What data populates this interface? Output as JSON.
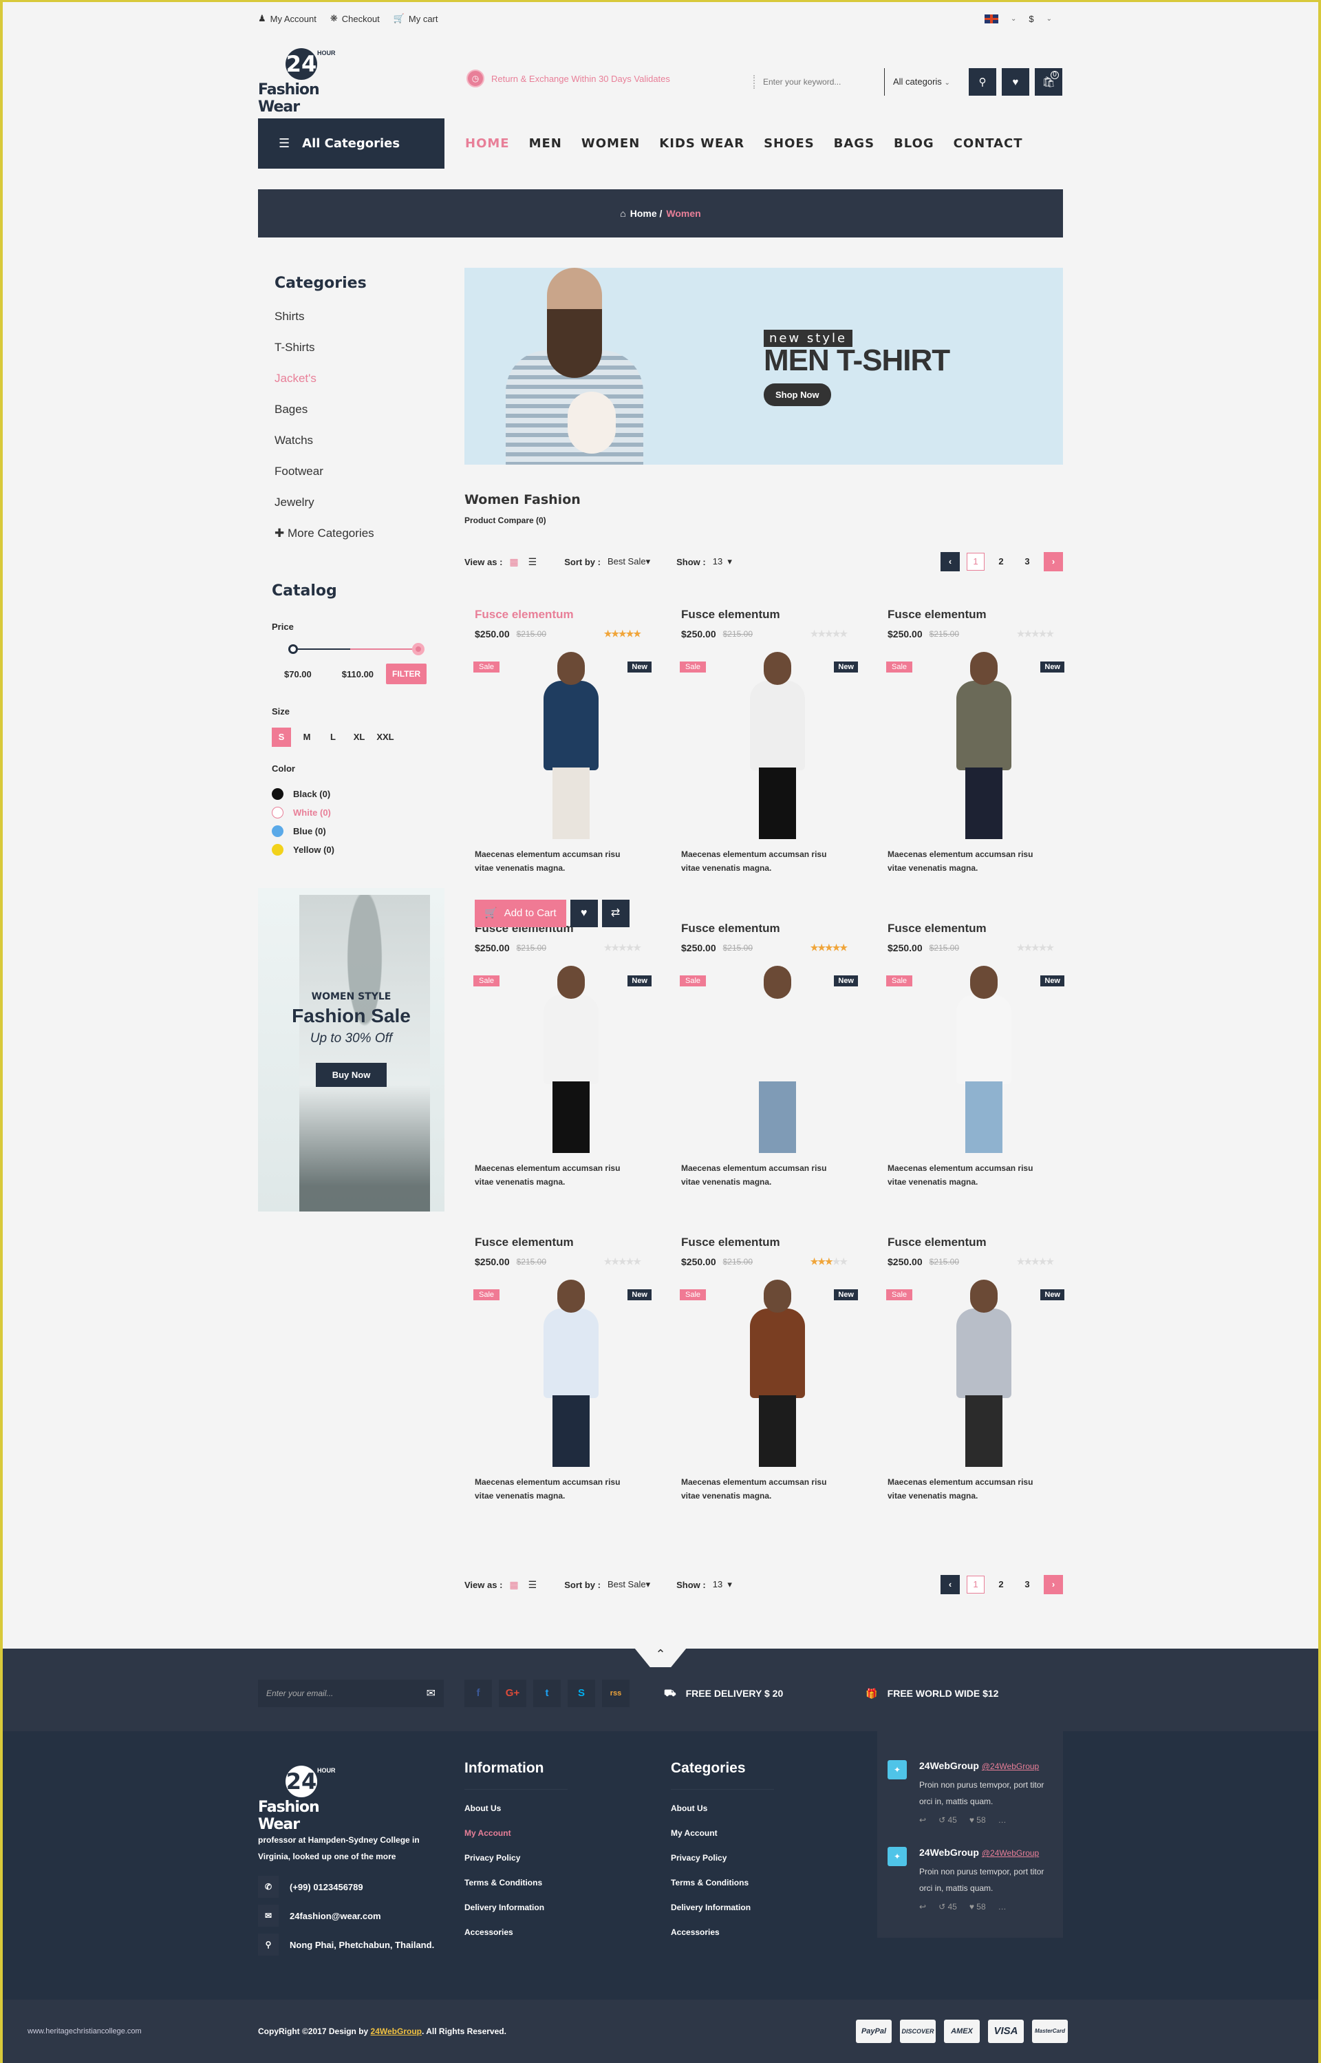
{
  "topbar": {
    "my_account": "My Account",
    "checkout": "Checkout",
    "my_cart": "My cart",
    "currency": "$"
  },
  "header": {
    "logo_number": "24",
    "logo_hour": "HOUR",
    "logo_name": "Fashion Wear",
    "promo_text": "Return & Exchange  Within 30 Days Validates",
    "search_placeholder": "Enter your keyword...",
    "category_select": "All categoris",
    "cart_count": "0"
  },
  "nav": {
    "all_categories": "All Categories",
    "items": [
      "HOME",
      "MEN",
      "WOMEN",
      "KIDS WEAR",
      "SHOES",
      "BAGS",
      "BLOG",
      "CONTACT"
    ],
    "active": "HOME"
  },
  "breadcrumb": {
    "home": "Home /",
    "current": "Women"
  },
  "sidebar": {
    "categories_title": "Categories",
    "categories": [
      "Shirts",
      "T-Shirts",
      "Jacket's",
      "Bages",
      "Watchs",
      "Footwear",
      "Jewelry"
    ],
    "active_category": "Jacket's",
    "more": "More Categories",
    "catalog_title": "Catalog",
    "price_label": "Price",
    "price_min": "$70.00",
    "price_max": "$110.00",
    "filter_button": "FILTER",
    "size_label": "Size",
    "sizes": [
      "S",
      "M",
      "L",
      "XL",
      "XXL"
    ],
    "selected_size": "S",
    "color_label": "Color",
    "colors": [
      {
        "name": "Black (0)",
        "hex": "#111111"
      },
      {
        "name": "White (0)",
        "hex": "#ffffff"
      },
      {
        "name": "Blue (0)",
        "hex": "#5aa9e8"
      },
      {
        "name": "Yellow (0)",
        "hex": "#f2d21b"
      }
    ],
    "active_color": "White (0)",
    "banner": {
      "eyebrow": "WOMEN STYLE",
      "title": "Fashion Sale",
      "subtitle": "Up to 30% Off",
      "button": "Buy Now"
    }
  },
  "hero": {
    "eyebrow": "new style",
    "title": "MEN T-SHIRT",
    "button": "Shop Now"
  },
  "listing": {
    "title": "Women Fashion",
    "compare": "Product Compare (0)",
    "view_as": "View as :",
    "sort_by": "Sort by :",
    "sort_value": "Best Sale",
    "show": "Show :",
    "show_value": "13",
    "pages": [
      "1",
      "2",
      "3"
    ],
    "current_page": "1"
  },
  "product_labels": {
    "sale": "Sale",
    "new": "New",
    "add_to_cart": "Add to Cart"
  },
  "products": [
    {
      "name": "Fusce elementum",
      "price": "$250.00",
      "old_price": "$215.00",
      "rating": 5,
      "desc": "Maecenas elementum accumsan risu vitae venenatis magna.",
      "active": true,
      "hover": true,
      "shirt": "#1f3d60",
      "leg": "#e9e4dd"
    },
    {
      "name": "Fusce elementum",
      "price": "$250.00",
      "old_price": "$215.00",
      "rating": 0,
      "desc": "Maecenas elementum accumsan risu vitae venenatis magna.",
      "shirt": "#eeeeee",
      "leg": "#111111"
    },
    {
      "name": "Fusce elementum",
      "price": "$250.00",
      "old_price": "$215.00",
      "rating": 0,
      "desc": "Maecenas elementum accumsan risu vitae venenatis magna.",
      "shirt": "#6b6a58",
      "leg": "#1d2233"
    },
    {
      "name": "Fusce elementum",
      "price": "$250.00",
      "old_price": "$215.00",
      "rating": 0,
      "desc": "Maecenas elementum accumsan risu vitae venenatis magna.",
      "shirt": "#f2f2f2",
      "leg": "#111111"
    },
    {
      "name": "Fusce elementum",
      "price": "$250.00",
      "old_price": "$215.00",
      "rating": 5,
      "desc": "Maecenas elementum accumsan risu vitae venenatis magna.",
      "shirt": "#f4f4f4",
      "leg": "#7f9bb6"
    },
    {
      "name": "Fusce elementum",
      "price": "$250.00",
      "old_price": "$215.00",
      "rating": 0,
      "desc": "Maecenas elementum accumsan risu vitae venenatis magna.",
      "shirt": "#f6f6f6",
      "leg": "#8fb2cf"
    },
    {
      "name": "Fusce elementum",
      "price": "$250.00",
      "old_price": "$215.00",
      "rating": 0,
      "desc": "Maecenas elementum accumsan risu vitae venenatis magna.",
      "shirt": "#dfe8f3",
      "leg": "#1f2b3e"
    },
    {
      "name": "Fusce elementum",
      "price": "$250.00",
      "old_price": "$215.00",
      "rating": 3,
      "desc": "Maecenas elementum accumsan risu vitae venenatis magna.",
      "shirt": "#7a3e22",
      "leg": "#1c1c1c"
    },
    {
      "name": "Fusce elementum",
      "price": "$250.00",
      "old_price": "$215.00",
      "rating": 0,
      "desc": "Maecenas elementum accumsan risu vitae venenatis magna.",
      "shirt": "#b8bec8",
      "leg": "#2b2b2b"
    }
  ],
  "footer": {
    "email_placeholder": "Enter your email...",
    "socials": [
      "f",
      "G+",
      "t",
      "S",
      "rss"
    ],
    "feature1": "FREE DELIVERY $ 20",
    "feature2": "FREE WORLD WIDE $12",
    "about_text": "professor at Hampden-Sydney College in Virginia, looked up one of the more",
    "phone": "(+99) 0123456789",
    "email": "24fashion@wear.com",
    "address": "Nong Phai, Phetchabun, Thailand.",
    "info_title": "Information",
    "info_links": [
      "About Us",
      "My Account",
      "Privacy Policy",
      "Terms & Conditions",
      "Delivery Information",
      "Accessories"
    ],
    "info_active": "My Account",
    "cat_title": "Categories",
    "cat_links": [
      "About Us",
      "My Account",
      "Privacy Policy",
      "Terms & Conditions",
      "Delivery Information",
      "Accessories"
    ],
    "tweets": [
      {
        "name": "24WebGroup",
        "handle": "@24WebGroup",
        "text": "Proin non purus temvpor, port titor orci in, mattis quam.",
        "retweets": "45",
        "likes": "58"
      },
      {
        "name": "24WebGroup",
        "handle": "@24WebGroup",
        "text": "Proin non purus temvpor, port titor orci in, mattis quam.",
        "retweets": "45",
        "likes": "58"
      }
    ],
    "copyright_prefix": "CopyRight ©2017  Design by ",
    "designer": "24WebGroup",
    "copyright_suffix": ". All Rights Reserved.",
    "site_url": "www.heritagechristiancollege.com",
    "payment_cards": [
      "PayPal",
      "DISCOVER",
      "AMEX",
      "VISA",
      "MasterCard"
    ]
  }
}
